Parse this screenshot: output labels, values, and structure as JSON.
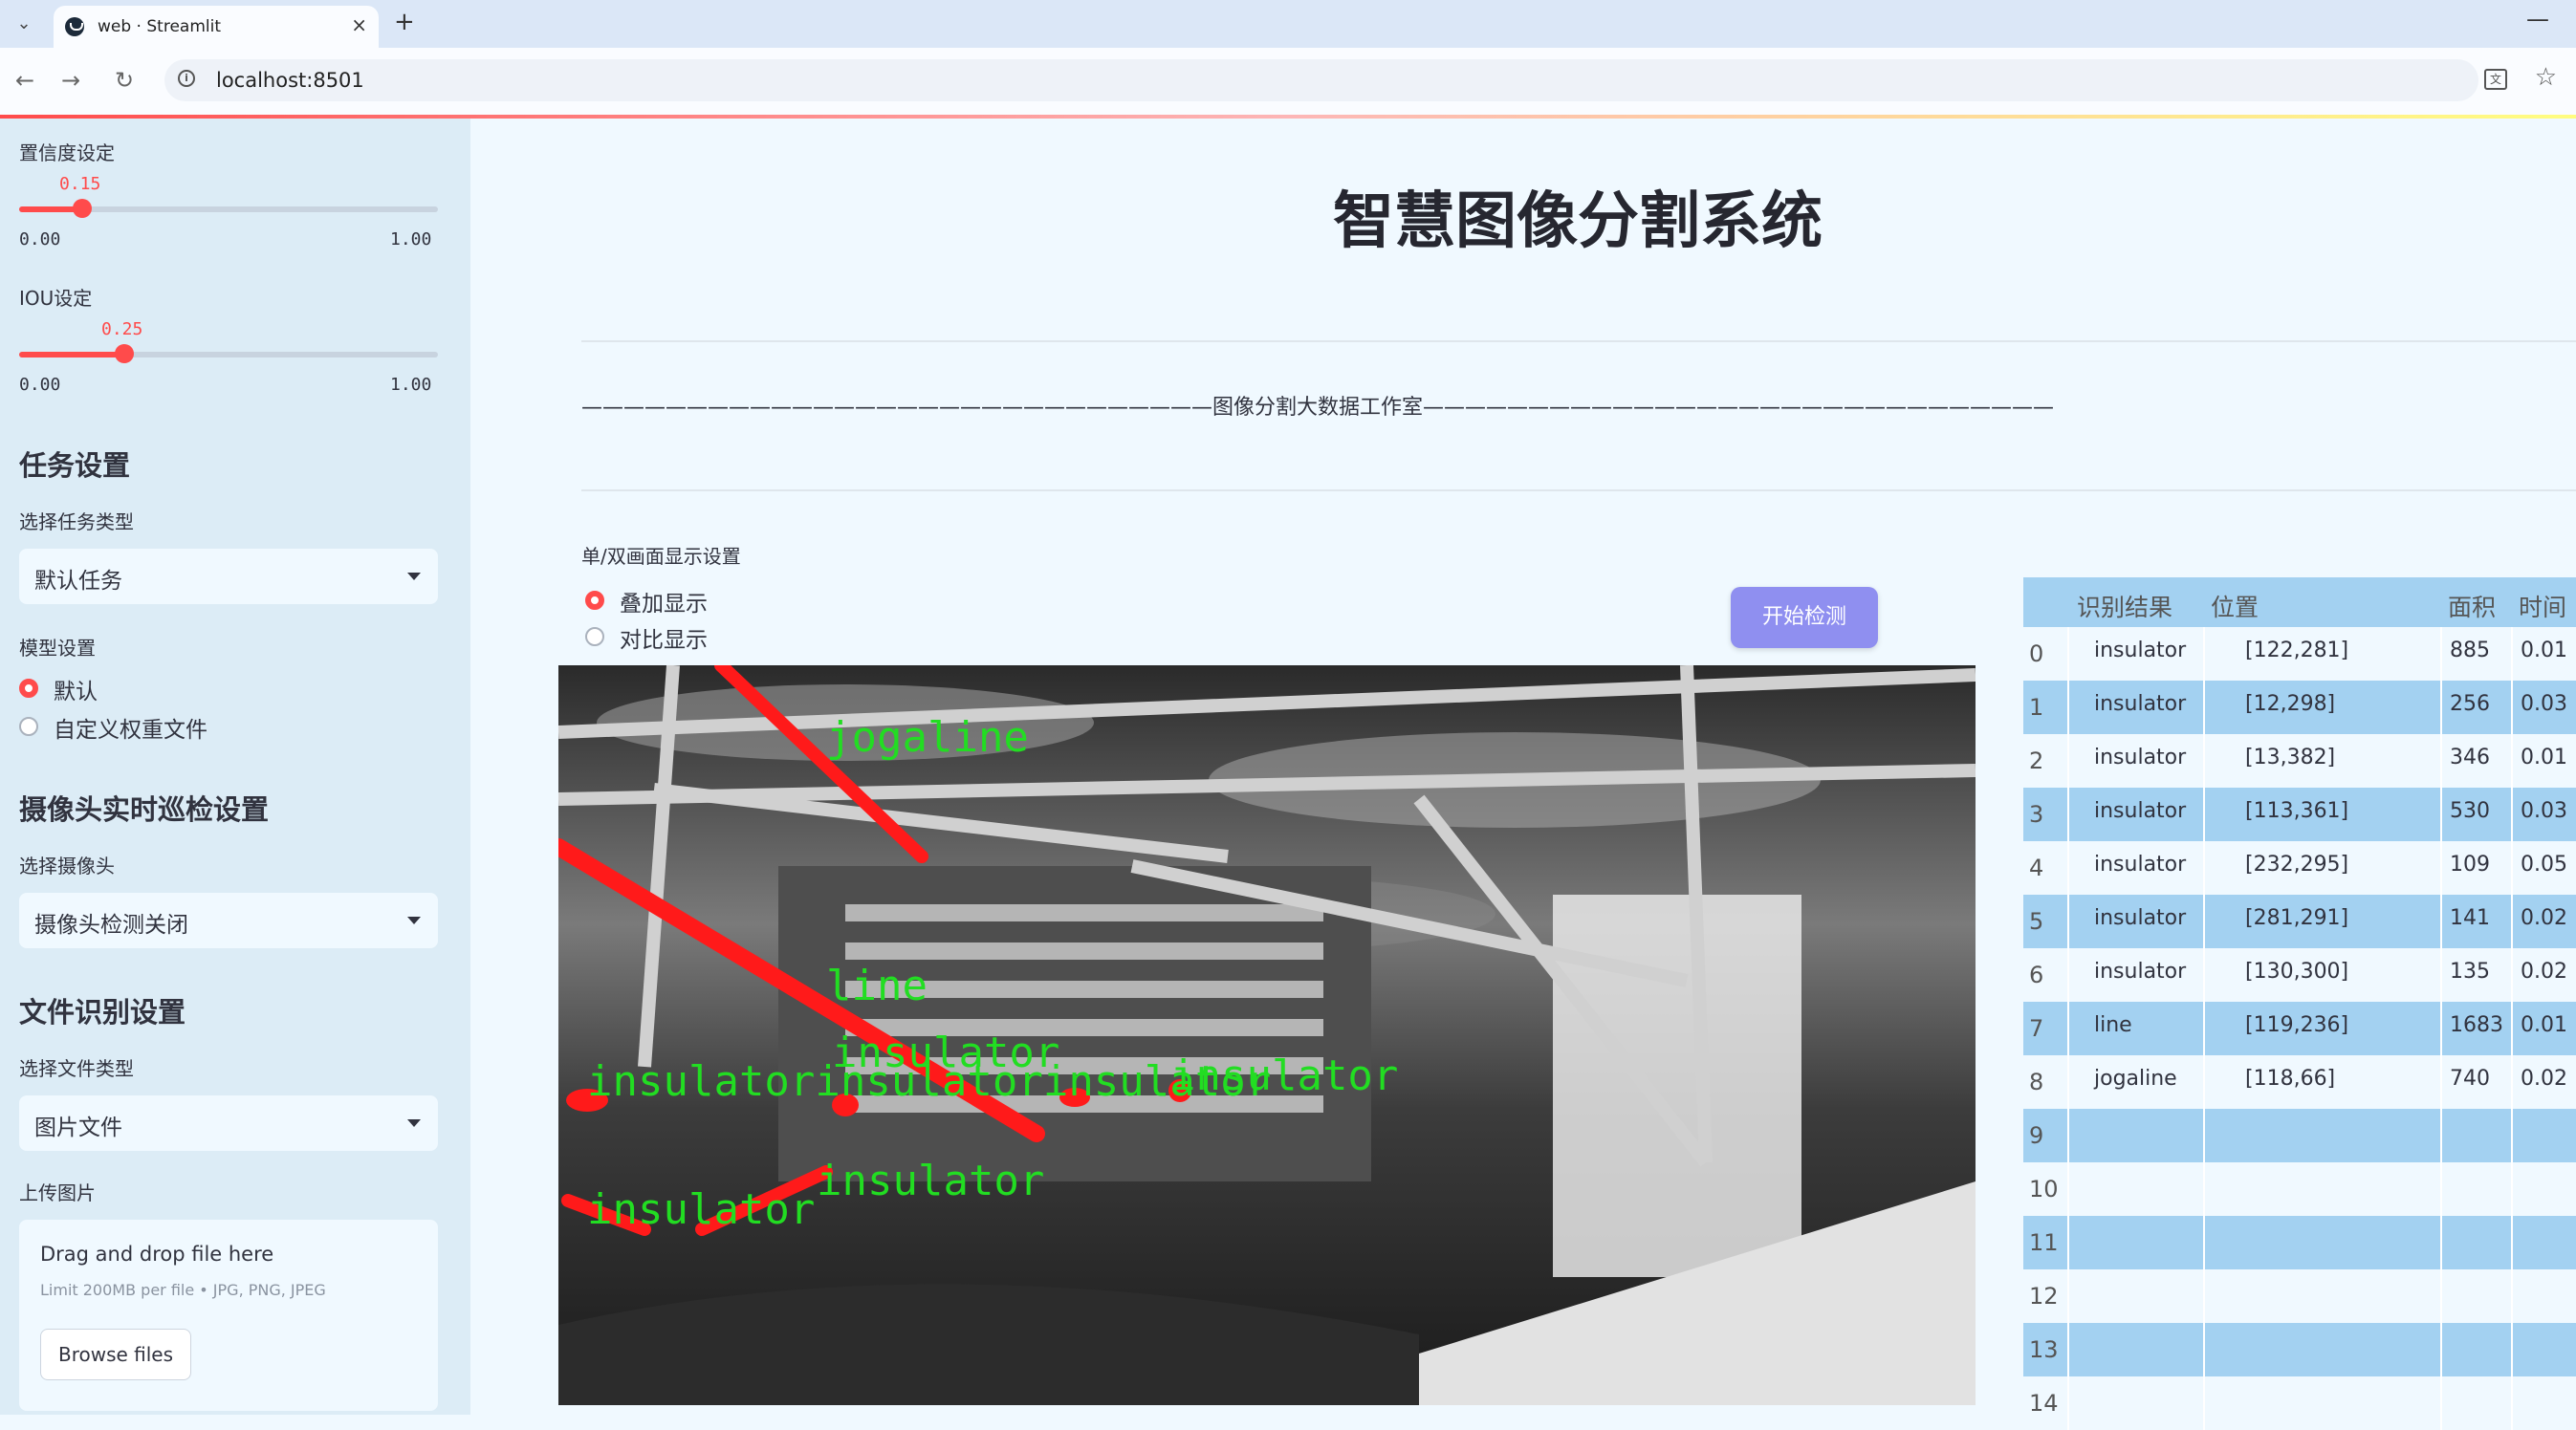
{
  "browser": {
    "tab_title": "web · Streamlit",
    "url": "localhost:8501",
    "icons": [
      "tab-list-icon",
      "close-icon",
      "new-tab-icon",
      "minimize-icon",
      "back-icon",
      "forward-icon",
      "reload-icon",
      "site-info-icon",
      "translate-icon",
      "bookmark-star-icon"
    ]
  },
  "sidebar": {
    "confidence": {
      "label": "置信度设定",
      "value": "0.15",
      "fraction": 0.15,
      "min": "0.00",
      "max": "1.00"
    },
    "iou": {
      "label": "IOU设定",
      "value": "0.25",
      "fraction": 0.25,
      "min": "0.00",
      "max": "1.00"
    },
    "task_heading": "任务设置",
    "task_type_label": "选择任务类型",
    "task_type_value": "默认任务",
    "model_label": "模型设置",
    "model_options": [
      "默认",
      "自定义权重文件"
    ],
    "model_selected": 0,
    "camera_heading": "摄像头实时巡检设置",
    "camera_label": "选择摄像头",
    "camera_value": "摄像头检测关闭",
    "file_heading": "文件识别设置",
    "file_type_label": "选择文件类型",
    "file_type_value": "图片文件",
    "upload_label": "上传图片",
    "upload_main": "Drag and drop file here",
    "upload_sub": "Limit 200MB per file • JPG, PNG, JPEG",
    "browse_label": "Browse files"
  },
  "main": {
    "title": "智慧图像分割系统",
    "studio": "——————————————————————————————图像分割大数据工作室——————————————————————————————",
    "display_label": "单/双画面显示设置",
    "display_options": [
      "叠加显示",
      "对比显示"
    ],
    "display_selected": 0,
    "start_button": "开始检测",
    "detection_labels": [
      "jogaline",
      "line",
      "insulator",
      "insulatorinsulatorinsulator",
      "insulator",
      "insulator",
      "insulator"
    ]
  },
  "table": {
    "headers": [
      "识别结果",
      "位置",
      "面积",
      "时间"
    ],
    "rows": [
      {
        "idx": "0",
        "label": "insulator",
        "pos": "[122,281]",
        "area": "885",
        "time": "0.01"
      },
      {
        "idx": "1",
        "label": "insulator",
        "pos": "[12,298]",
        "area": "256",
        "time": "0.03"
      },
      {
        "idx": "2",
        "label": "insulator",
        "pos": "[13,382]",
        "area": "346",
        "time": "0.01"
      },
      {
        "idx": "3",
        "label": "insulator",
        "pos": "[113,361]",
        "area": "530",
        "time": "0.03"
      },
      {
        "idx": "4",
        "label": "insulator",
        "pos": "[232,295]",
        "area": "109",
        "time": "0.05"
      },
      {
        "idx": "5",
        "label": "insulator",
        "pos": "[281,291]",
        "area": "141",
        "time": "0.02"
      },
      {
        "idx": "6",
        "label": "insulator",
        "pos": "[130,300]",
        "area": "135",
        "time": "0.02"
      },
      {
        "idx": "7",
        "label": "line",
        "pos": "[119,236]",
        "area": "1683",
        "time": "0.01"
      },
      {
        "idx": "8",
        "label": "jogaline",
        "pos": "[118,66]",
        "area": "740",
        "time": "0.02"
      },
      {
        "idx": "9",
        "label": "",
        "pos": "",
        "area": "",
        "time": ""
      },
      {
        "idx": "10",
        "label": "",
        "pos": "",
        "area": "",
        "time": ""
      },
      {
        "idx": "11",
        "label": "",
        "pos": "",
        "area": "",
        "time": ""
      },
      {
        "idx": "12",
        "label": "",
        "pos": "",
        "area": "",
        "time": ""
      },
      {
        "idx": "13",
        "label": "",
        "pos": "",
        "area": "",
        "time": ""
      },
      {
        "idx": "14",
        "label": "",
        "pos": "",
        "area": "",
        "time": ""
      }
    ]
  },
  "colors": {
    "accent": "#ff4b4b",
    "sidebar_bg": "#dcecf6",
    "page_bg": "#f0f9ff",
    "table_stripe": "#a3d1f1",
    "button": "#8f8ff0",
    "mask": "#ff1a1a",
    "label_green": "#22dd22"
  }
}
